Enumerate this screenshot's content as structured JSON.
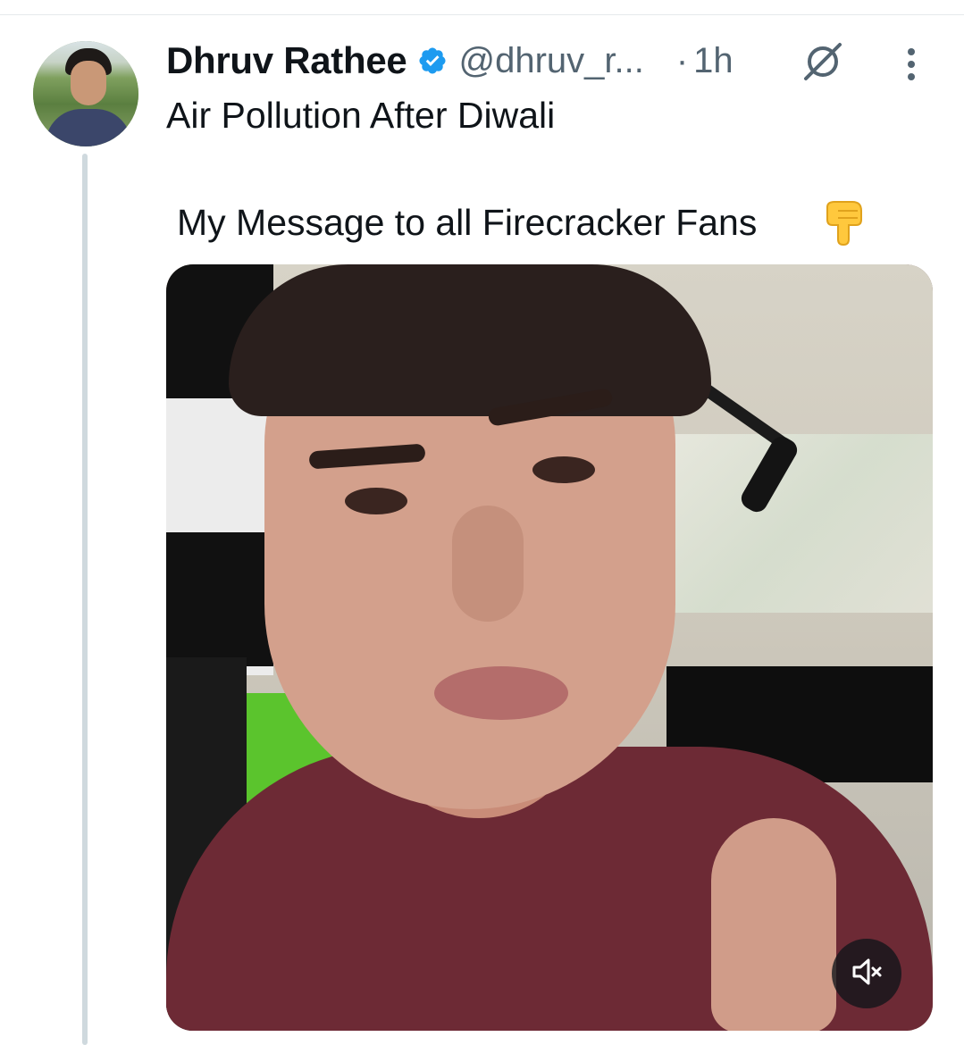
{
  "tweet": {
    "author": {
      "display_name": "Dhruv Rathee",
      "handle": "@dhruv_r...",
      "verified": true
    },
    "separator": "·",
    "time": "1h",
    "text_line_1": "Air Pollution After Diwali",
    "text_line_2": "My Message to all Firecracker Fans",
    "emoji": "backhand-index-pointing-down-icon"
  },
  "media": {
    "type": "video",
    "muted": true
  },
  "colors": {
    "text_primary": "#0f1419",
    "text_secondary": "#536471",
    "verified_blue": "#1d9bf0",
    "thread_line": "#cfd9de"
  }
}
